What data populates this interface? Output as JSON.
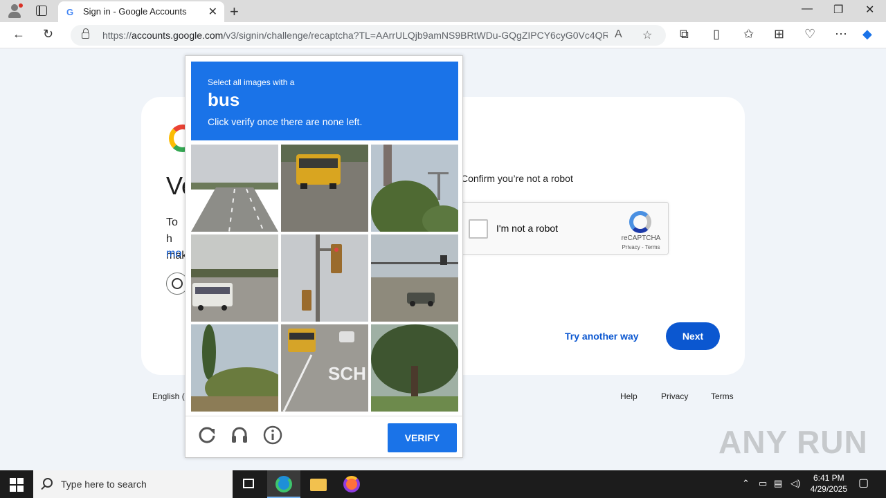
{
  "browser": {
    "tab_title": "Sign in - Google Accounts",
    "tab_favicon": "G",
    "url_prefix": "https://",
    "url_domain": "accounts.google.com",
    "url_path": "/v3/signin/challenge/recaptcha?TL=AArrULQjb9amNS9BRtWDu-GQgZIPCY6cyG0Vc4QR...",
    "window_controls": [
      "minimize-icon",
      "restore-icon",
      "close-icon"
    ]
  },
  "page": {
    "title_partial": "Ve",
    "text_line1_partial": "To h",
    "text_line2_partial": "mak",
    "more_link_partial": "mo",
    "confirm_text": "Confirm you’re not a robot",
    "checkbox_label": "I'm not a robot",
    "recaptcha_brand": "reCAPTCHA",
    "recaptcha_links": "Privacy - Terms",
    "try_another": "Try another way",
    "next": "Next",
    "footer": {
      "language_partial": "English (",
      "help": "Help",
      "privacy": "Privacy",
      "terms": "Terms"
    }
  },
  "challenge": {
    "line1": "Select all images with a",
    "target": "bus",
    "line3": "Click verify once there are none left.",
    "tiles": [
      {
        "subject": "highway"
      },
      {
        "subject": "school-bus"
      },
      {
        "subject": "tree-and-pole"
      },
      {
        "subject": "bus-on-road"
      },
      {
        "subject": "traffic-light"
      },
      {
        "subject": "intersection-car"
      },
      {
        "subject": "trees"
      },
      {
        "subject": "school-bus-street"
      },
      {
        "subject": "tree"
      }
    ],
    "tile_road_text": "SCH",
    "verify_label": "VERIFY",
    "colors": {
      "accent": "#1a73e8"
    }
  },
  "watermark": "ANY RUN",
  "taskbar": {
    "search_placeholder": "Type here to search",
    "time": "6:41 PM",
    "date": "4/29/2025"
  }
}
